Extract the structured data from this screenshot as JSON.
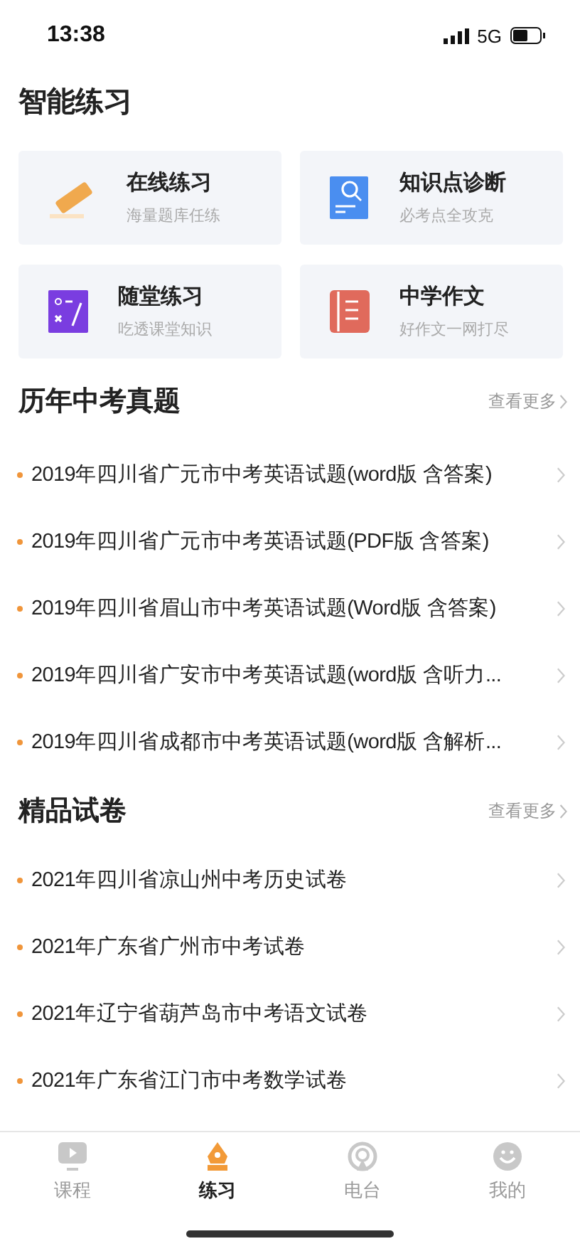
{
  "status_bar": {
    "time": "13:38",
    "network": "5G"
  },
  "title": "智能练习",
  "cards": [
    {
      "title": "在线练习",
      "subtitle": "海量题库任练"
    },
    {
      "title": "知识点诊断",
      "subtitle": "必考点全攻克"
    },
    {
      "title": "随堂练习",
      "subtitle": "吃透课堂知识"
    },
    {
      "title": "中学作文",
      "subtitle": "好作文一网打尽"
    }
  ],
  "sections": [
    {
      "title": "历年中考真题",
      "more": "查看更多",
      "items": [
        "2019年四川省广元市中考英语试题(word版 含答案)",
        "2019年四川省广元市中考英语试题(PDF版 含答案)",
        "2019年四川省眉山市中考英语试题(Word版 含答案)",
        "2019年四川省广安市中考英语试题(word版 含听力...",
        "2019年四川省成都市中考英语试题(word版 含解析..."
      ]
    },
    {
      "title": "精品试卷",
      "more": "查看更多",
      "items": [
        "2021年四川省凉山州中考历史试卷",
        "2021年广东省广州市中考试卷",
        "2021年辽宁省葫芦岛市中考语文试卷",
        "2021年广东省江门市中考数学试卷"
      ]
    }
  ],
  "tabs": [
    {
      "label": "课程",
      "selected": false
    },
    {
      "label": "练习",
      "selected": true
    },
    {
      "label": "电台",
      "selected": false
    },
    {
      "label": "我的",
      "selected": false
    }
  ]
}
